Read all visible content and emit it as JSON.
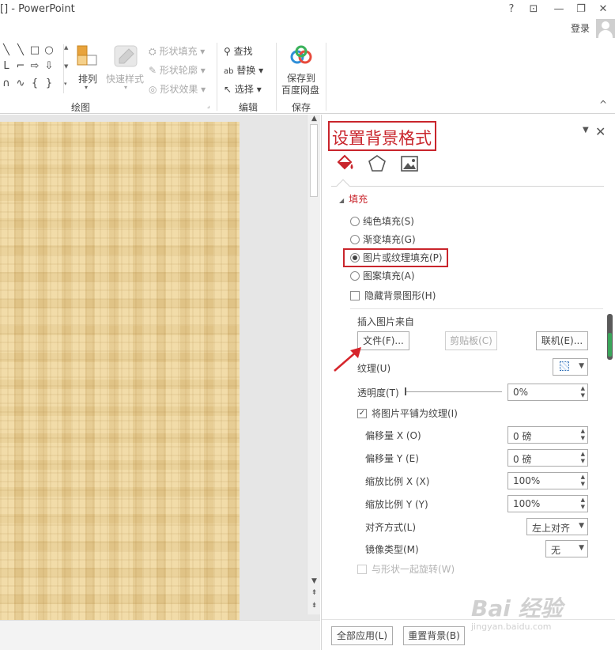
{
  "titlebar": {
    "title": "[] - PowerPoint",
    "help": "?",
    "ribbon_display": "⊡",
    "minimize": "—",
    "restore": "❐",
    "close": "✕",
    "login": "登录"
  },
  "ribbon": {
    "shapes": [
      "╲",
      "╲",
      "□",
      "○",
      "L",
      "⌐",
      "⇨",
      "⇩",
      "∩",
      "∿",
      "{",
      "}"
    ],
    "arrange_label": "排列",
    "quick_styles_label": "快速样式",
    "shape_fill": "形状填充",
    "shape_outline": "形状轮廓",
    "shape_effects": "形状效果",
    "drawing_group": "绘图",
    "find": "查找",
    "replace": "替换",
    "select": "选择",
    "editing_group": "编辑",
    "save_to_line1": "保存到",
    "save_to_line2": "百度网盘",
    "save_group": "保存",
    "collapse": "^"
  },
  "pane": {
    "title": "设置背景格式",
    "section_fill": "填充",
    "fill_options": [
      {
        "label": "纯色填充(S)",
        "selected": false
      },
      {
        "label": "渐变填充(G)",
        "selected": false
      },
      {
        "label": "图片或纹理填充(P)",
        "selected": true
      },
      {
        "label": "图案填充(A)",
        "selected": false
      }
    ],
    "hide_bg_graphics": "隐藏背景图形(H)",
    "insert_from": "插入图片来自",
    "file_button": "文件(F)...",
    "clipboard_button": "剪贴板(C)",
    "online_button": "联机(E)...",
    "texture_label": "纹理(U)",
    "transparency_label": "透明度(T)",
    "transparency_value": "0%",
    "transparency": 0,
    "tile_label": "将图片平铺为纹理(I)",
    "tile_checked": true,
    "offset_x_label": "偏移量 X (O)",
    "offset_x_value": "0 磅",
    "offset_y_label": "偏移量 Y (E)",
    "offset_y_value": "0 磅",
    "scale_x_label": "缩放比例 X (X)",
    "scale_x_value": "100%",
    "scale_y_label": "缩放比例 Y (Y)",
    "scale_y_value": "100%",
    "align_label": "对齐方式(L)",
    "align_value": "左上对齐",
    "mirror_label": "镜像类型(M)",
    "mirror_value": "无",
    "rotate_label": "与形状一起旋转(W)",
    "apply_all_button": "全部应用(L)",
    "reset_bg_button": "重置背景(B)"
  },
  "watermark": {
    "brand": "Bai 经验",
    "url": "jingyan.baidu.com"
  },
  "colors": {
    "accent_red": "#c9252c",
    "texture": "#e9cf95"
  }
}
